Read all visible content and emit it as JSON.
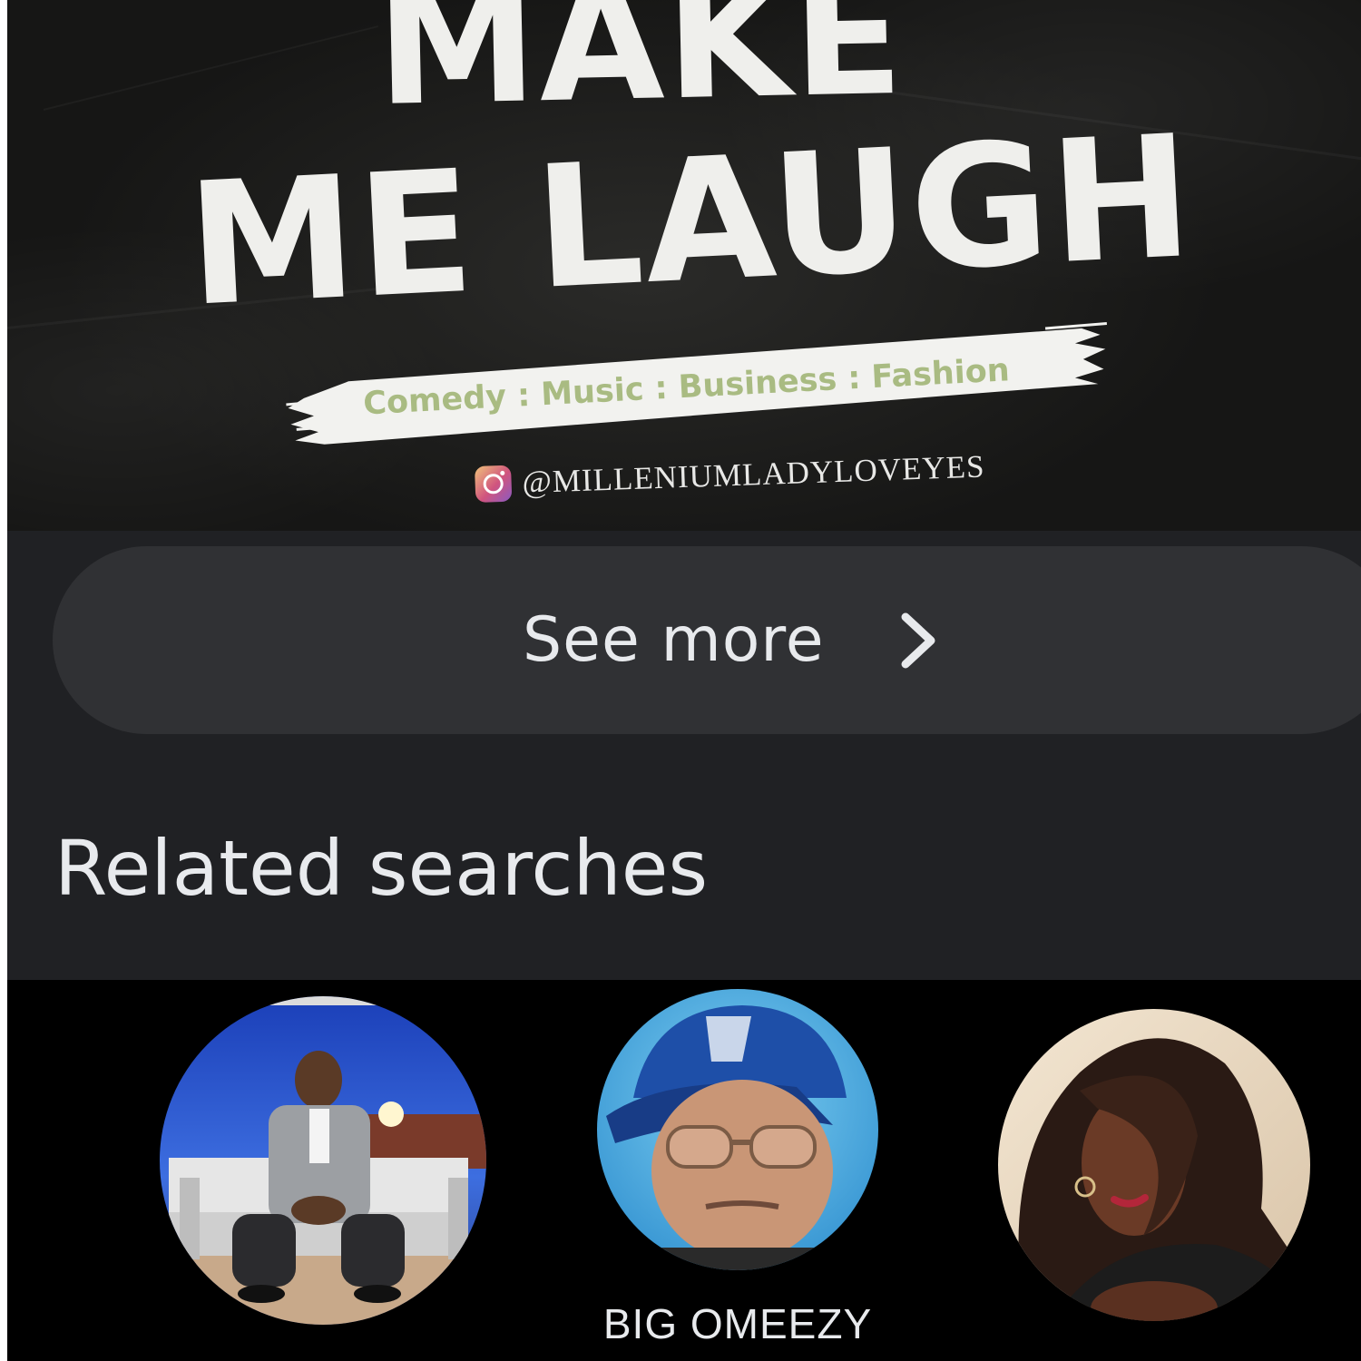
{
  "banner": {
    "headline_line1": "MAKE",
    "headline_line2": "ME LAUGH",
    "tagline": "Comedy : Music : Business : Fashion",
    "social_icon": "instagram-icon",
    "social_handle": "@MILLENIUMLADYLOVEYES"
  },
  "see_more": {
    "label": "See more",
    "icon": "chevron-right-icon"
  },
  "related": {
    "title": "Related searches",
    "items": [
      {
        "name": ""
      },
      {
        "name": "BIG OMEEZY"
      },
      {
        "name": ""
      }
    ]
  },
  "colors": {
    "page_background": "#202124",
    "pill_background": "#303134",
    "carousel_background": "#000000",
    "text_primary": "#e8eaed",
    "tagline_green": "#a9bb82"
  }
}
